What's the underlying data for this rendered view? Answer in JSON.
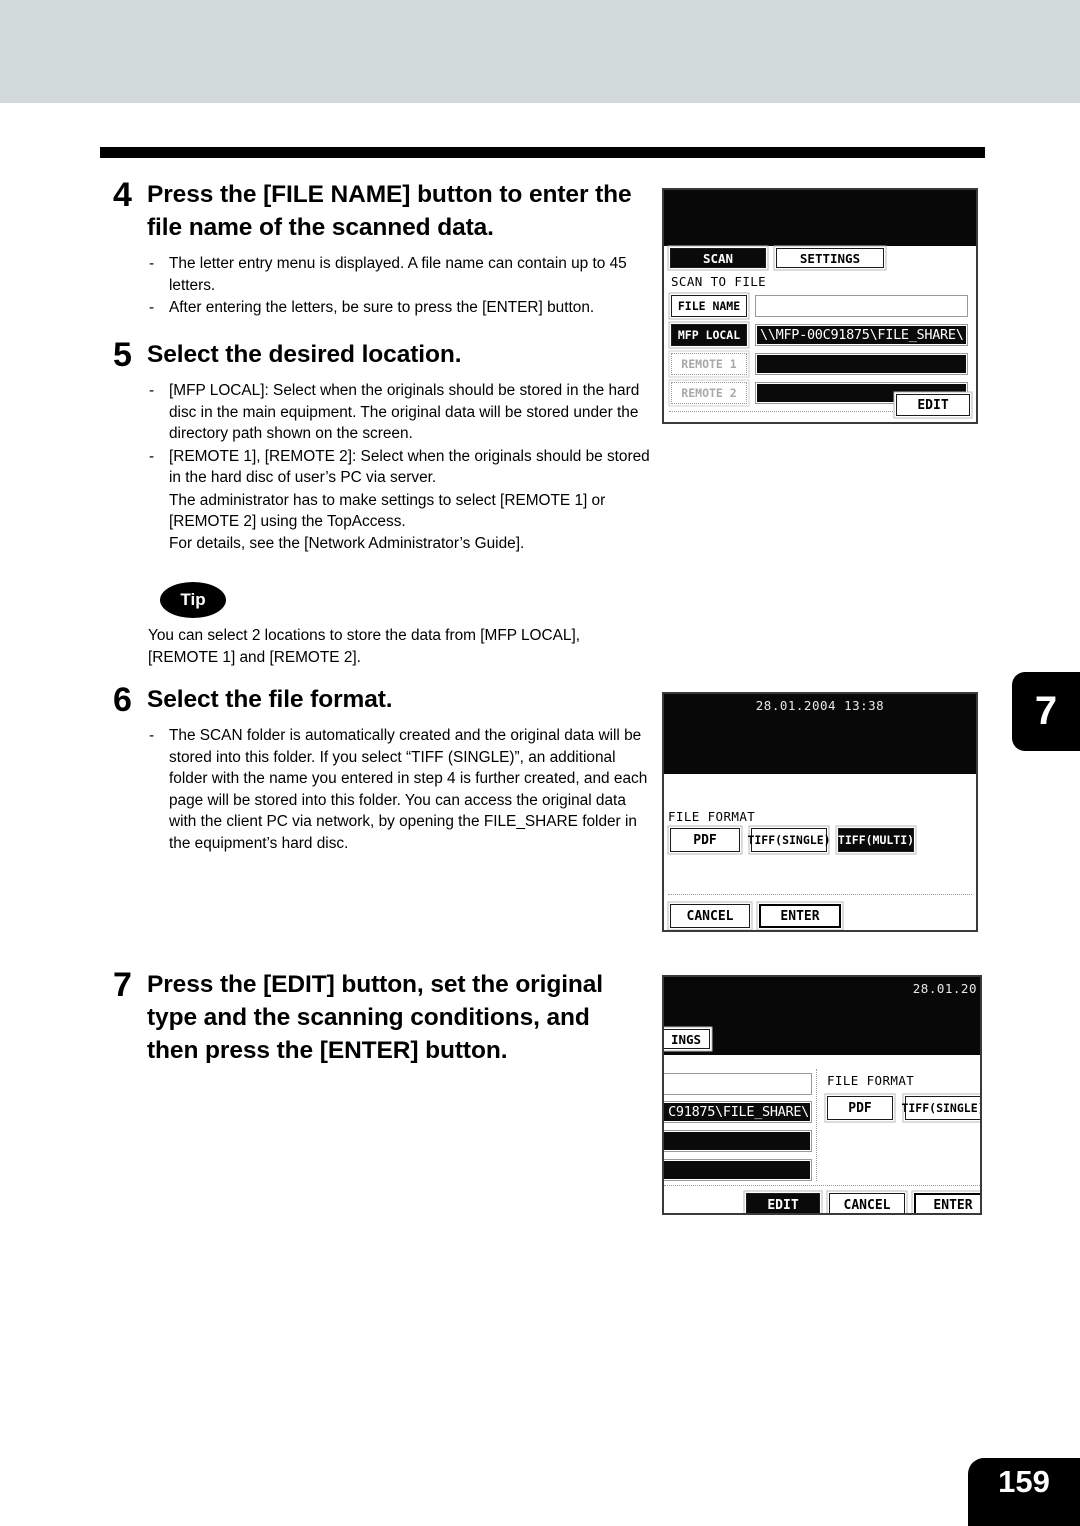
{
  "page": {
    "number": "159",
    "chapter_tab": "7"
  },
  "steps": [
    {
      "num": "4",
      "heading": "Press the [FILE NAME] button to enter the file name of the scanned data.",
      "bullets": [
        "The letter entry menu is displayed. A file name can contain up to 45 letters.",
        "After entering the letters, be sure to press the [ENTER] button."
      ]
    },
    {
      "num": "5",
      "heading": "Select the desired location.",
      "bullets": [
        "[MFP LOCAL]: Select when the originals should be stored in the hard disc in the main equipment. The original data will be stored under the directory path shown on the screen.",
        "[REMOTE 1], [REMOTE 2]: Select when the originals should be stored in the hard disc of user’s PC via server."
      ],
      "sub_lines": [
        "The administrator has to make settings to select [REMOTE 1] or [REMOTE 2] using the TopAccess.",
        "For details, see the [Network Administrator’s Guide]."
      ]
    },
    {
      "num": "6",
      "heading": "Select the file format.",
      "bullets": [
        "The SCAN folder is automatically created and the original data will be stored into this folder. If you select “TIFF (SINGLE)”, an additional folder with the name you entered in step 4 is further created, and each page will be stored into this folder. You can access the original data with the client PC via network, by opening the FILE_SHARE folder in the equipment’s hard disc."
      ]
    },
    {
      "num": "7",
      "heading": "Press the [EDIT] button, set the original type and the scanning conditions, and then press the [ENTER] button.",
      "bullets": []
    }
  ],
  "tip": {
    "badge": "Tip",
    "body": "You can select 2 locations to store the data from [MFP LOCAL], [REMOTE 1] and [REMOTE 2]."
  },
  "screen1": {
    "tabs": [
      {
        "label": "SCAN",
        "selected": true
      },
      {
        "label": "SETTINGS",
        "selected": false
      }
    ],
    "title": "SCAN TO FILE",
    "rows": [
      {
        "button": "FILE NAME",
        "state": "active",
        "value": "",
        "value_state": "empty-white"
      },
      {
        "button": "MFP LOCAL",
        "state": "active",
        "value": "\\\\MFP-00C91875\\FILE_SHARE\\",
        "value_state": "filled"
      },
      {
        "button": "REMOTE 1",
        "state": "disabled",
        "value": "",
        "value_state": "blank"
      },
      {
        "button": "REMOTE 2",
        "state": "disabled",
        "value": "",
        "value_state": "blank"
      }
    ],
    "edit_button": "EDIT"
  },
  "screen2": {
    "datetime": "28.01.2004 13:38",
    "file_format_label": "FILE FORMAT",
    "formats": [
      {
        "label": "PDF",
        "selected": false
      },
      {
        "label": "TIFF(SINGLE)",
        "selected": false
      },
      {
        "label": "TIFF(MULTI)",
        "selected": true
      }
    ],
    "cancel_button": "CANCEL",
    "enter_button": "ENTER"
  },
  "screen3": {
    "datetime": "28.01.20",
    "tab_partial": "INGS",
    "path_partial": "C91875\\FILE_SHARE\\",
    "file_format_label": "FILE FORMAT",
    "formats": [
      {
        "label": "PDF",
        "selected": false
      },
      {
        "label": "TIFF(SINGLE)",
        "selected": false
      }
    ],
    "edit_button": "EDIT",
    "cancel_button": "CANCEL",
    "enter_button": "ENTER"
  }
}
